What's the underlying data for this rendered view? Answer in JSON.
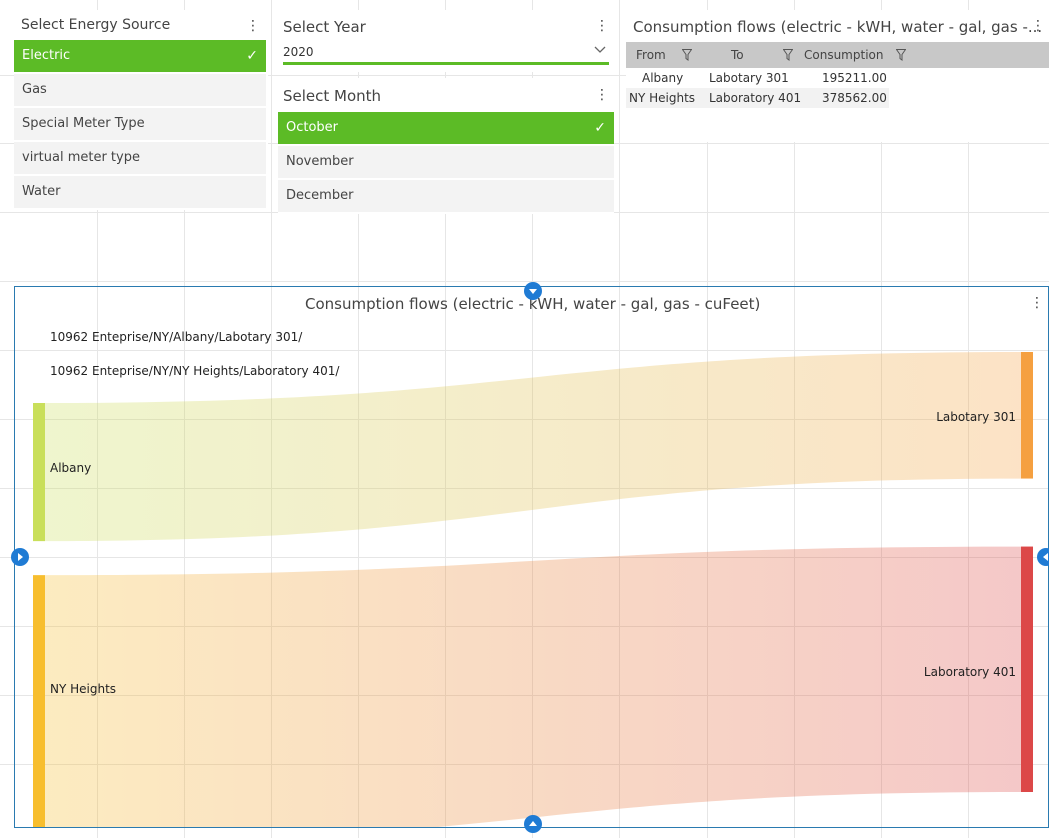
{
  "energy_slicer": {
    "title": "Select Energy Source",
    "items": [
      {
        "label": "Electric",
        "selected": true
      },
      {
        "label": "Gas",
        "selected": false
      },
      {
        "label": "Special Meter Type",
        "selected": false
      },
      {
        "label": "virtual meter type",
        "selected": false
      },
      {
        "label": "Water",
        "selected": false
      }
    ]
  },
  "year_slicer": {
    "title": "Select Year",
    "value": "2020"
  },
  "month_slicer": {
    "title": "Select Month",
    "items": [
      {
        "label": "October",
        "selected": true
      },
      {
        "label": "November",
        "selected": false
      },
      {
        "label": "December",
        "selected": false
      }
    ]
  },
  "flows_table": {
    "title": "Consumption flows (electric - kWH, water - gal, gas -...",
    "columns": [
      "From",
      "To",
      "Consumption"
    ],
    "rows": [
      [
        "Albany",
        "Labotary 301",
        "195211.00"
      ],
      [
        "NY Heights",
        "Laboratory 401",
        "378562.00"
      ]
    ]
  },
  "sankey": {
    "title": "Consumption flows (electric - kWH, water - gal, gas - cuFeet)",
    "paths": [
      "10962 Enteprise/NY/Albany/Labotary 301/",
      "10962 Enteprise/NY/NY Heights/Laboratory 401/"
    ],
    "chart_data": {
      "type": "sankey",
      "links": [
        {
          "source": "Albany",
          "target": "Labotary 301",
          "value": 195211.0
        },
        {
          "source": "NY Heights",
          "target": "Laboratory 401",
          "value": 378562.0
        }
      ],
      "colors": {
        "Albany": "#c9df5a",
        "Labotary 301": "#f5a040",
        "NY Heights": "#f7be2e",
        "Laboratory 401": "#dc4848"
      }
    }
  },
  "colors": {
    "accent": "#5cbb26",
    "handle": "#1f7bd4",
    "panel_border": "#2a7ab0"
  }
}
